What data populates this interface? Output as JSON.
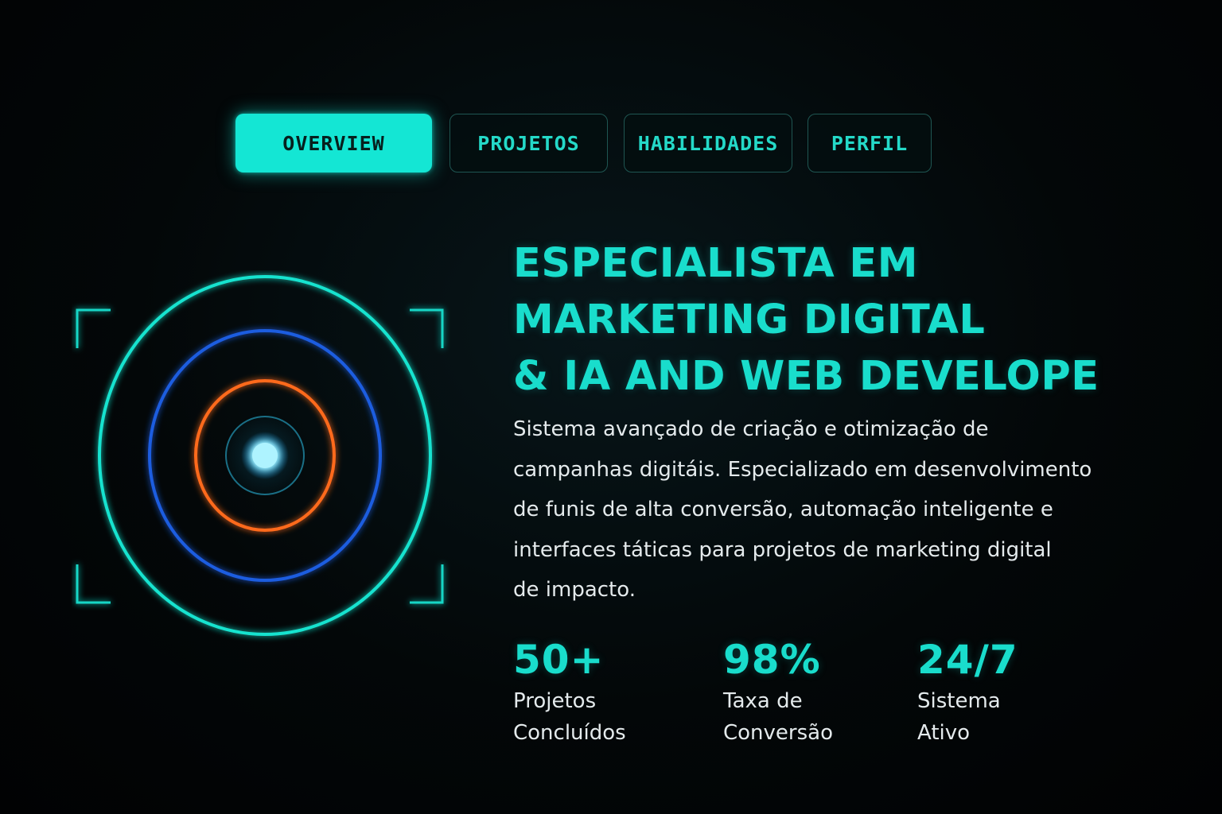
{
  "nav": {
    "tabs": [
      {
        "label": "OVERVIEW",
        "active": true
      },
      {
        "label": "PROJETOS",
        "active": false
      },
      {
        "label": "HABILIDADES",
        "active": false
      },
      {
        "label": "PERFIL",
        "active": false
      }
    ]
  },
  "hero": {
    "title_lines": [
      "ESPECIALISTA EM",
      "MARKETING DIGITAL",
      "& IA AND WEB DEVELOPE"
    ],
    "description_lines": [
      "Sistema avançado de criação e otimização de",
      "campanhas digitáis. Especializado em desenvolvimento",
      "de funis de alta conversão, automação inteligente e",
      "interfaces táticas para projetos de marketing digital",
      "de impacto."
    ]
  },
  "stats": [
    {
      "value": "50+",
      "label_lines": [
        "Projetos",
        "Concluídos"
      ]
    },
    {
      "value": "98%",
      "label_lines": [
        "Taxa de",
        "Conversão"
      ]
    },
    {
      "value": "24/7",
      "label_lines": [
        "Sistema",
        "Ativo"
      ]
    }
  ],
  "radar_icon": "radar-target-icon",
  "colors": {
    "accent": "#14e6d4",
    "ring_outer": "#19e3cf",
    "ring_middle": "#1f5de0",
    "ring_inner": "#ff6a1a",
    "core": "#9ff0ff",
    "background": "#020405"
  }
}
